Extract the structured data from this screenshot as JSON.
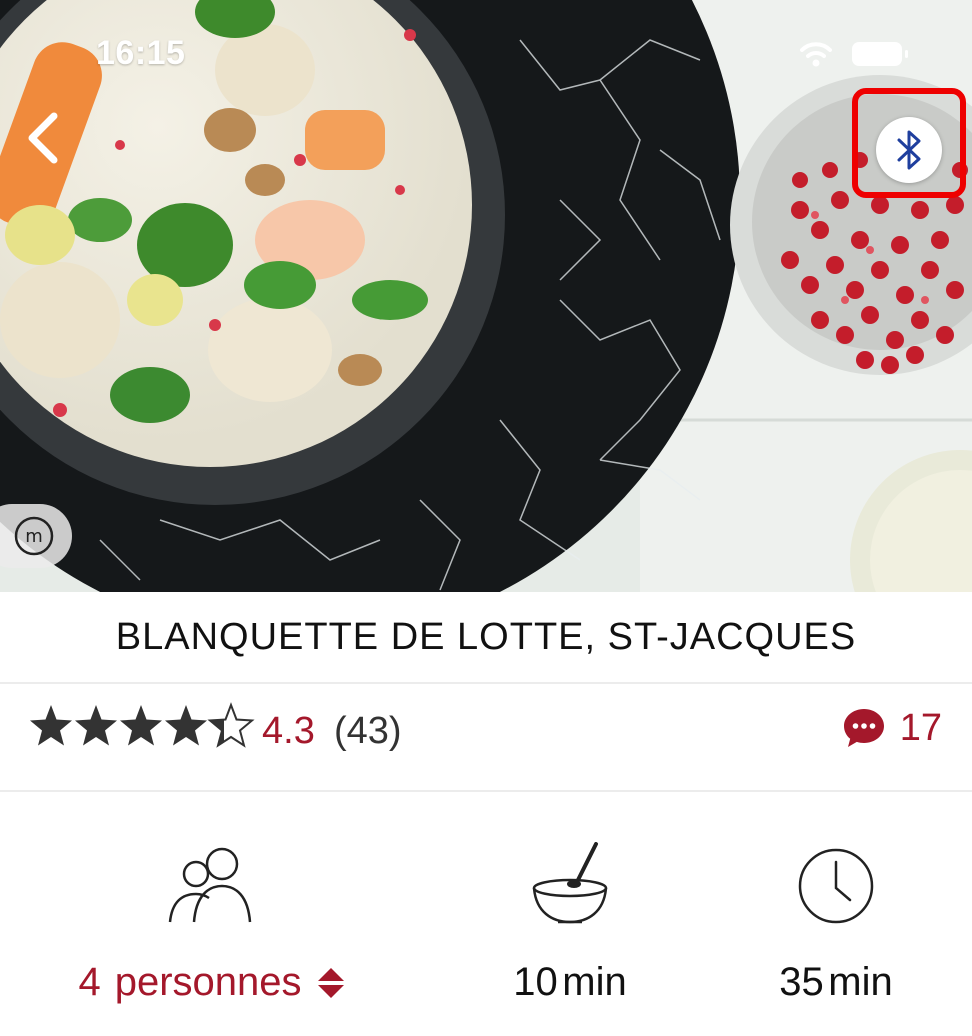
{
  "status_bar": {
    "time": "16:15"
  },
  "recipe": {
    "title": "BLANQUETTE DE LOTTE, ST-JACQUES",
    "rating": {
      "value": "4.3",
      "count_text": "(43)",
      "stars_filled": 4.3,
      "stars_max": 5
    },
    "comments_count": "17"
  },
  "info": {
    "servings": {
      "number": "4",
      "unit": "personnes"
    },
    "prep": {
      "number": "10",
      "unit": "min"
    },
    "total": {
      "number": "35",
      "unit": "min"
    }
  },
  "colors": {
    "accent": "#a4182b",
    "text": "#111111",
    "highlight": "#ee0000",
    "bluetooth": "#1f3f9e"
  },
  "icons": [
    "back-chevron-icon",
    "bluetooth-icon",
    "m-logo-icon",
    "star-icon",
    "comment-bubble-icon",
    "people-icon",
    "bowl-icon",
    "clock-icon",
    "sort-arrows-icon"
  ]
}
